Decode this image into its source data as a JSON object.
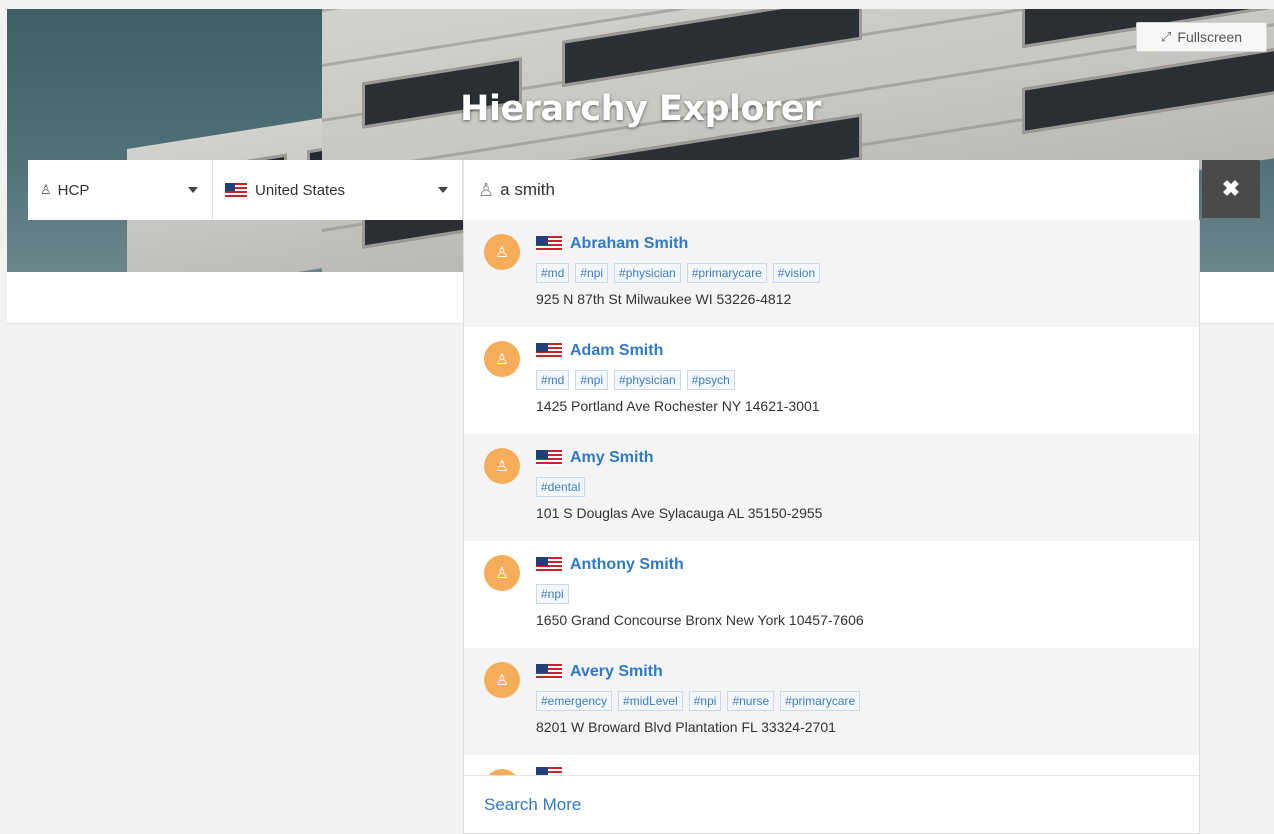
{
  "header": {
    "title": "Hierarchy Explorer",
    "fullscreen_label": "Fullscreen"
  },
  "search": {
    "type_selector": {
      "value": "HCP",
      "icon": "user-md-icon"
    },
    "country_selector": {
      "value": "United States",
      "flag": "us-flag"
    },
    "query": "a smith",
    "clear_icon": "close-icon"
  },
  "results": [
    {
      "name": "Abraham Smith",
      "tags": [
        "#md",
        "#npi",
        "#physician",
        "#primarycare",
        "#vision"
      ],
      "address": "925 N 87th St Milwaukee WI 53226-4812"
    },
    {
      "name": "Adam Smith",
      "tags": [
        "#md",
        "#npi",
        "#physician",
        "#psych"
      ],
      "address": "1425 Portland Ave Rochester NY 14621-3001"
    },
    {
      "name": "Amy Smith",
      "tags": [
        "#dental"
      ],
      "address": "101 S Douglas Ave Sylacauga AL 35150-2955"
    },
    {
      "name": "Anthony Smith",
      "tags": [
        "#npi"
      ],
      "address": "1650 Grand Concourse Bronx New York 10457-7606"
    },
    {
      "name": "Avery Smith",
      "tags": [
        "#emergency",
        "#midLevel",
        "#npi",
        "#nurse",
        "#primarycare"
      ],
      "address": "8201 W Broward Blvd Plantation FL 33324-2701"
    }
  ],
  "search_more_label": "Search More",
  "colors": {
    "accent": "#2f7ac8",
    "avatar": "#f6ad5a",
    "clear_button": "#4a4a4a"
  }
}
